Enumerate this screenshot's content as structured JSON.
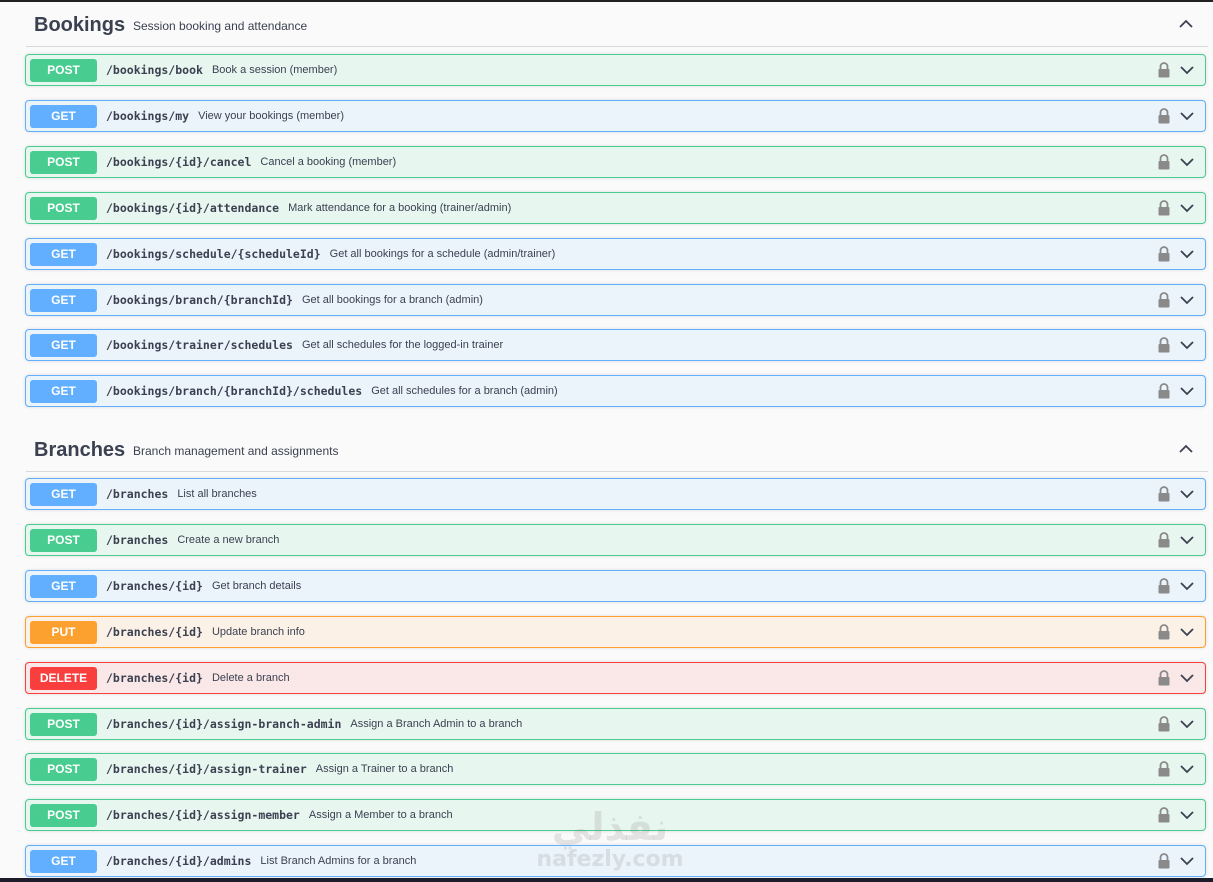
{
  "sections": [
    {
      "title": "Bookings",
      "description": "Session booking and attendance",
      "operations": [
        {
          "method": "POST",
          "path": "/bookings/book",
          "summary": "Book a session (member)"
        },
        {
          "method": "GET",
          "path": "/bookings/my",
          "summary": "View your bookings (member)"
        },
        {
          "method": "POST",
          "path": "/bookings/{id}/cancel",
          "summary": "Cancel a booking (member)"
        },
        {
          "method": "POST",
          "path": "/bookings/{id}/attendance",
          "summary": "Mark attendance for a booking (trainer/admin)"
        },
        {
          "method": "GET",
          "path": "/bookings/schedule/{scheduleId}",
          "summary": "Get all bookings for a schedule (admin/trainer)"
        },
        {
          "method": "GET",
          "path": "/bookings/branch/{branchId}",
          "summary": "Get all bookings for a branch (admin)"
        },
        {
          "method": "GET",
          "path": "/bookings/trainer/schedules",
          "summary": "Get all schedules for the logged-in trainer"
        },
        {
          "method": "GET",
          "path": "/bookings/branch/{branchId}/schedules",
          "summary": "Get all schedules for a branch (admin)"
        }
      ]
    },
    {
      "title": "Branches",
      "description": "Branch management and assignments",
      "operations": [
        {
          "method": "GET",
          "path": "/branches",
          "summary": "List all branches"
        },
        {
          "method": "POST",
          "path": "/branches",
          "summary": "Create a new branch"
        },
        {
          "method": "GET",
          "path": "/branches/{id}",
          "summary": "Get branch details"
        },
        {
          "method": "PUT",
          "path": "/branches/{id}",
          "summary": "Update branch info"
        },
        {
          "method": "DELETE",
          "path": "/branches/{id}",
          "summary": "Delete a branch"
        },
        {
          "method": "POST",
          "path": "/branches/{id}/assign-branch-admin",
          "summary": "Assign a Branch Admin to a branch"
        },
        {
          "method": "POST",
          "path": "/branches/{id}/assign-trainer",
          "summary": "Assign a Trainer to a branch"
        },
        {
          "method": "POST",
          "path": "/branches/{id}/assign-member",
          "summary": "Assign a Member to a branch"
        },
        {
          "method": "GET",
          "path": "/branches/{id}/admins",
          "summary": "List Branch Admins for a branch"
        }
      ]
    }
  ],
  "watermark": {
    "arabic": "نفذلي",
    "latin": "nafezly.com"
  },
  "colors": {
    "get": "#61affe",
    "post": "#49cc90",
    "put": "#fca130",
    "delete": "#f93e3e"
  },
  "icons": {
    "lock": "lock-icon",
    "expand": "chevron-down-icon",
    "collapse": "chevron-up-icon"
  }
}
